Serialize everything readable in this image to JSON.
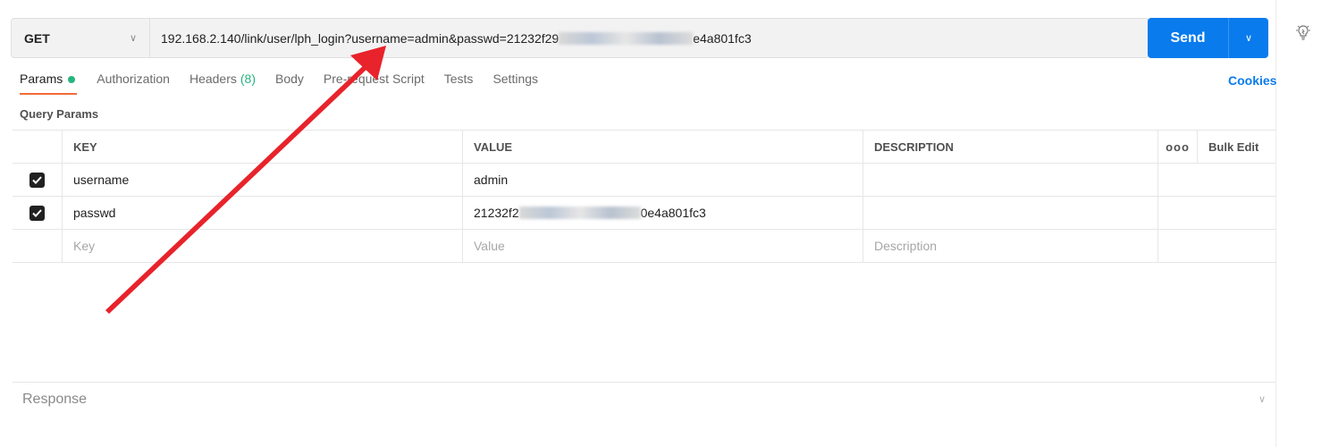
{
  "request": {
    "method": "GET",
    "url_prefix": "192.168.2.140/link/user/lph_login?username=admin&passwd=21232f29",
    "url_suffix": "e4a801fc3",
    "send_label": "Send"
  },
  "tabs": [
    {
      "label": "Params"
    },
    {
      "label": "Authorization"
    },
    {
      "label": "Headers",
      "count": "(8)"
    },
    {
      "label": "Body"
    },
    {
      "label": "Pre-request Script"
    },
    {
      "label": "Tests"
    },
    {
      "label": "Settings"
    }
  ],
  "cookies_label": "Cookies",
  "query_params_title": "Query Params",
  "table": {
    "headers": {
      "key": "KEY",
      "value": "VALUE",
      "description": "DESCRIPTION",
      "more": "ooo",
      "bulk_edit": "Bulk Edit"
    },
    "rows": [
      {
        "key": "username",
        "value": "admin",
        "checked": true
      },
      {
        "key": "passwd",
        "value_prefix": "21232f2",
        "value_suffix": "0e4a801fc3",
        "checked": true
      }
    ],
    "placeholders": {
      "key": "Key",
      "value": "Value",
      "description": "Description"
    }
  },
  "response_label": "Response",
  "colors": {
    "accent": "#097bed",
    "active_tab": "#f26b3a",
    "dot": "#26b47f",
    "annotation": "#e8232b"
  },
  "icons": [
    "chevron-down-icon",
    "lightbulb-icon",
    "checkbox-checked-icon",
    "more-icon",
    "red-arrow-annotation"
  ]
}
